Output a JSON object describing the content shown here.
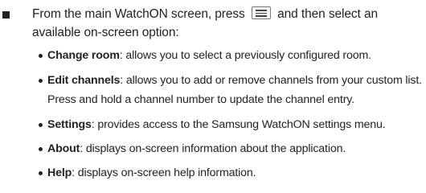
{
  "intro": {
    "before_icon": "From the main WatchON screen, press",
    "menu_icon": "menu-icon",
    "after_icon": "and then select an available on-screen option:"
  },
  "options": [
    {
      "term": "Change room",
      "description": ": allows you to select a previously configured room."
    },
    {
      "term": "Edit channels",
      "description": ": allows you to add or remove channels from your custom list. Press and hold a channel number to update the channel entry."
    },
    {
      "term": "Settings",
      "description": ": provides access to the Samsung WatchON settings menu."
    },
    {
      "term": "About",
      "description": ": displays on-screen information about the application."
    },
    {
      "term": "Help",
      "description": ": displays on-screen help information."
    }
  ]
}
